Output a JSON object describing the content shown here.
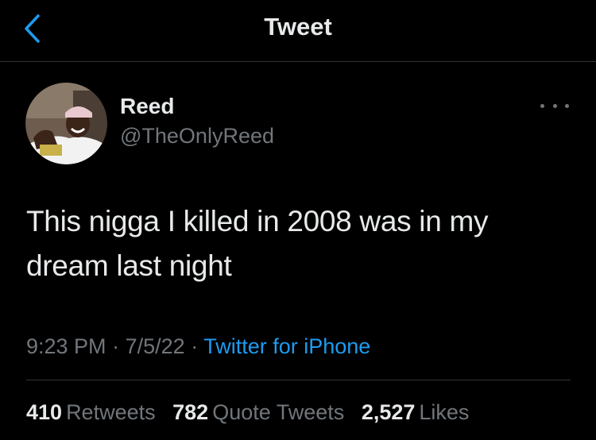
{
  "header": {
    "title": "Tweet",
    "back_icon": "chevron-left-icon"
  },
  "tweet": {
    "author": {
      "display_name": "Reed",
      "handle": "@TheOnlyReed",
      "avatar": "avatar-photo"
    },
    "more_icon": "more-horizontal-icon",
    "text_line_1": "This nigga I killed in 2008 was in my",
    "text_line_2": "dream last night",
    "time": "9:23 PM",
    "date": "7/5/22",
    "separator": "·",
    "source": "Twitter for iPhone"
  },
  "stats": {
    "retweets": {
      "count": "410",
      "label": "Retweets"
    },
    "quote_tweets": {
      "count": "782",
      "label": "Quote Tweets"
    },
    "likes": {
      "count": "2,527",
      "label": "Likes"
    }
  },
  "colors": {
    "background": "#000000",
    "primary_text": "#e7e9ea",
    "secondary_text": "#71767b",
    "accent": "#1d9bf0",
    "divider": "#2f3336"
  }
}
